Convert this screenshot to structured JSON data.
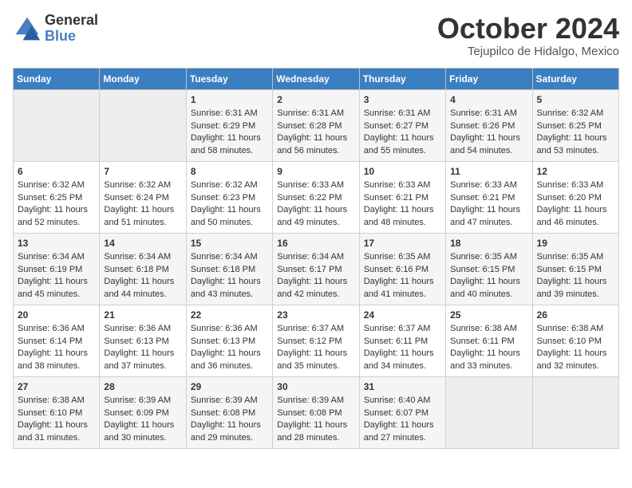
{
  "header": {
    "logo_general": "General",
    "logo_blue": "Blue",
    "month_title": "October 2024",
    "location": "Tejupilco de Hidalgo, Mexico"
  },
  "weekdays": [
    "Sunday",
    "Monday",
    "Tuesday",
    "Wednesday",
    "Thursday",
    "Friday",
    "Saturday"
  ],
  "weeks": [
    [
      {
        "day": "",
        "empty": true
      },
      {
        "day": "",
        "empty": true
      },
      {
        "day": "1",
        "sunrise": "6:31 AM",
        "sunset": "6:29 PM",
        "daylight": "11 hours and 58 minutes."
      },
      {
        "day": "2",
        "sunrise": "6:31 AM",
        "sunset": "6:28 PM",
        "daylight": "11 hours and 56 minutes."
      },
      {
        "day": "3",
        "sunrise": "6:31 AM",
        "sunset": "6:27 PM",
        "daylight": "11 hours and 55 minutes."
      },
      {
        "day": "4",
        "sunrise": "6:31 AM",
        "sunset": "6:26 PM",
        "daylight": "11 hours and 54 minutes."
      },
      {
        "day": "5",
        "sunrise": "6:32 AM",
        "sunset": "6:25 PM",
        "daylight": "11 hours and 53 minutes."
      }
    ],
    [
      {
        "day": "6",
        "sunrise": "6:32 AM",
        "sunset": "6:25 PM",
        "daylight": "11 hours and 52 minutes."
      },
      {
        "day": "7",
        "sunrise": "6:32 AM",
        "sunset": "6:24 PM",
        "daylight": "11 hours and 51 minutes."
      },
      {
        "day": "8",
        "sunrise": "6:32 AM",
        "sunset": "6:23 PM",
        "daylight": "11 hours and 50 minutes."
      },
      {
        "day": "9",
        "sunrise": "6:33 AM",
        "sunset": "6:22 PM",
        "daylight": "11 hours and 49 minutes."
      },
      {
        "day": "10",
        "sunrise": "6:33 AM",
        "sunset": "6:21 PM",
        "daylight": "11 hours and 48 minutes."
      },
      {
        "day": "11",
        "sunrise": "6:33 AM",
        "sunset": "6:21 PM",
        "daylight": "11 hours and 47 minutes."
      },
      {
        "day": "12",
        "sunrise": "6:33 AM",
        "sunset": "6:20 PM",
        "daylight": "11 hours and 46 minutes."
      }
    ],
    [
      {
        "day": "13",
        "sunrise": "6:34 AM",
        "sunset": "6:19 PM",
        "daylight": "11 hours and 45 minutes."
      },
      {
        "day": "14",
        "sunrise": "6:34 AM",
        "sunset": "6:18 PM",
        "daylight": "11 hours and 44 minutes."
      },
      {
        "day": "15",
        "sunrise": "6:34 AM",
        "sunset": "6:18 PM",
        "daylight": "11 hours and 43 minutes."
      },
      {
        "day": "16",
        "sunrise": "6:34 AM",
        "sunset": "6:17 PM",
        "daylight": "11 hours and 42 minutes."
      },
      {
        "day": "17",
        "sunrise": "6:35 AM",
        "sunset": "6:16 PM",
        "daylight": "11 hours and 41 minutes."
      },
      {
        "day": "18",
        "sunrise": "6:35 AM",
        "sunset": "6:15 PM",
        "daylight": "11 hours and 40 minutes."
      },
      {
        "day": "19",
        "sunrise": "6:35 AM",
        "sunset": "6:15 PM",
        "daylight": "11 hours and 39 minutes."
      }
    ],
    [
      {
        "day": "20",
        "sunrise": "6:36 AM",
        "sunset": "6:14 PM",
        "daylight": "11 hours and 38 minutes."
      },
      {
        "day": "21",
        "sunrise": "6:36 AM",
        "sunset": "6:13 PM",
        "daylight": "11 hours and 37 minutes."
      },
      {
        "day": "22",
        "sunrise": "6:36 AM",
        "sunset": "6:13 PM",
        "daylight": "11 hours and 36 minutes."
      },
      {
        "day": "23",
        "sunrise": "6:37 AM",
        "sunset": "6:12 PM",
        "daylight": "11 hours and 35 minutes."
      },
      {
        "day": "24",
        "sunrise": "6:37 AM",
        "sunset": "6:11 PM",
        "daylight": "11 hours and 34 minutes."
      },
      {
        "day": "25",
        "sunrise": "6:38 AM",
        "sunset": "6:11 PM",
        "daylight": "11 hours and 33 minutes."
      },
      {
        "day": "26",
        "sunrise": "6:38 AM",
        "sunset": "6:10 PM",
        "daylight": "11 hours and 32 minutes."
      }
    ],
    [
      {
        "day": "27",
        "sunrise": "6:38 AM",
        "sunset": "6:10 PM",
        "daylight": "11 hours and 31 minutes."
      },
      {
        "day": "28",
        "sunrise": "6:39 AM",
        "sunset": "6:09 PM",
        "daylight": "11 hours and 30 minutes."
      },
      {
        "day": "29",
        "sunrise": "6:39 AM",
        "sunset": "6:08 PM",
        "daylight": "11 hours and 29 minutes."
      },
      {
        "day": "30",
        "sunrise": "6:39 AM",
        "sunset": "6:08 PM",
        "daylight": "11 hours and 28 minutes."
      },
      {
        "day": "31",
        "sunrise": "6:40 AM",
        "sunset": "6:07 PM",
        "daylight": "11 hours and 27 minutes."
      },
      {
        "day": "",
        "empty": true
      },
      {
        "day": "",
        "empty": true
      }
    ]
  ],
  "labels": {
    "sunrise": "Sunrise:",
    "sunset": "Sunset:",
    "daylight": "Daylight:"
  }
}
